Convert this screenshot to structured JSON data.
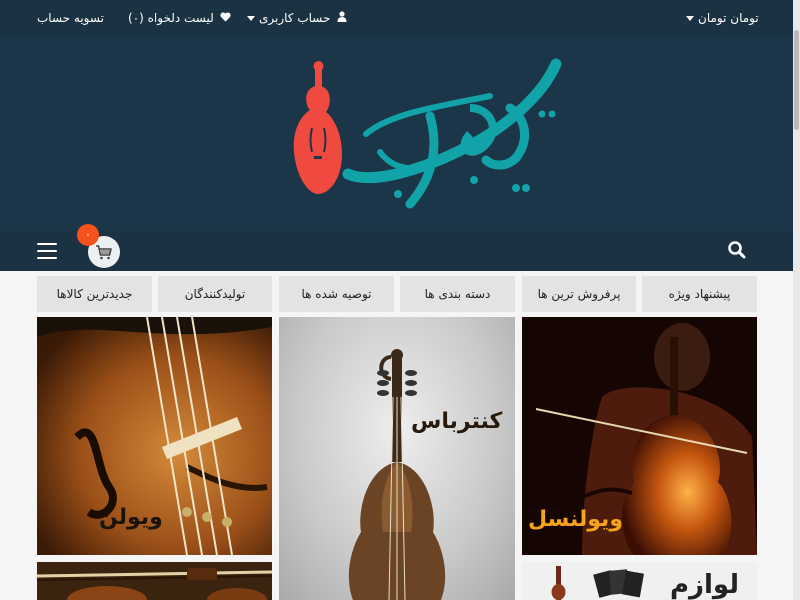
{
  "topbar": {
    "currency": "تومان تومان",
    "account": "حساب کاربری",
    "wishlist": "لیست دلخواه (۰)",
    "checkout": "تسویه حساب"
  },
  "header": {
    "logo_text": "شهر موسیقی"
  },
  "navbar": {
    "cart_count": "۰"
  },
  "tabs": [
    {
      "label": "پیشنهاد ویژه"
    },
    {
      "label": "پرفروش ترین ها"
    },
    {
      "label": "دسته بندی ها"
    },
    {
      "label": "توصیه شده ها"
    },
    {
      "label": "تولیدکنندگان"
    },
    {
      "label": "جدیدترین کالاها"
    }
  ],
  "tiles": {
    "cello": {
      "label": "ویولنسل"
    },
    "kontrabass": {
      "label": "کنترباس"
    },
    "violin": {
      "label": "ویولن"
    },
    "accessories": {
      "label": "لوازم"
    }
  },
  "colors": {
    "topbar": "#1a3242",
    "header": "#1c3649",
    "logo_teal": "#12a3a8",
    "violin_red": "#f04a40",
    "badge": "#f4511e",
    "cello_label": "#f6a21d"
  },
  "icons": {
    "account": "user-icon",
    "wishlist": "heart-icon",
    "search": "search-icon",
    "cart": "cart-icon",
    "menu": "hamburger-icon"
  }
}
